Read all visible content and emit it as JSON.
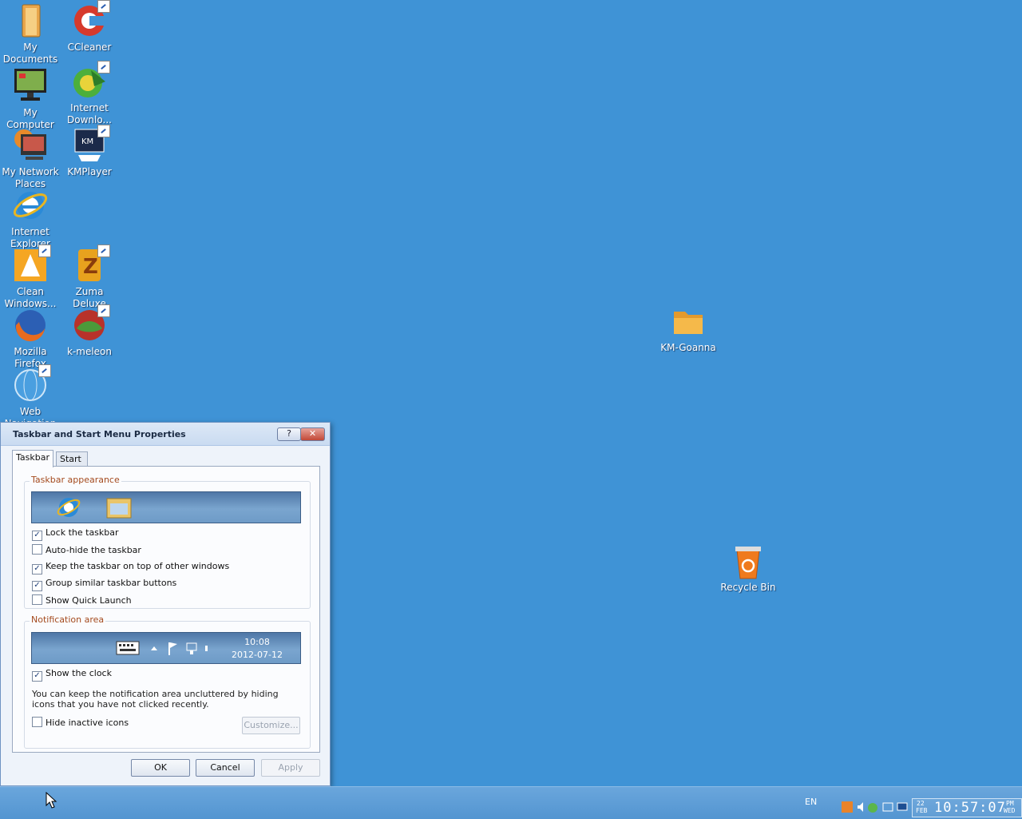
{
  "desktop": {
    "icons": [
      {
        "label": "My Documents"
      },
      {
        "label": "CCleaner"
      },
      {
        "label": "My Computer"
      },
      {
        "label": "Internet Downlo..."
      },
      {
        "label": "My Network Places"
      },
      {
        "label": "KMPlayer"
      },
      {
        "label": "Internet Explorer"
      },
      {
        "label": "Clean Windows..."
      },
      {
        "label": "Zuma Deluxe"
      },
      {
        "label": "Mozilla Firefox"
      },
      {
        "label": "k-meleon"
      },
      {
        "label": "Web Navigation"
      },
      {
        "label": "KM-Goanna"
      },
      {
        "label": "Recycle Bin"
      }
    ]
  },
  "dialog": {
    "title": "Taskbar and Start Menu Properties",
    "help_label": "?",
    "close_label": "✕",
    "tabs": [
      {
        "label": "Taskbar"
      },
      {
        "label": "Start Menu"
      }
    ],
    "appearance": {
      "group_label": "Taskbar appearance",
      "options": [
        {
          "label": "Lock the taskbar",
          "mark": "✓"
        },
        {
          "label": "Auto-hide the taskbar",
          "mark": ""
        },
        {
          "label": "Keep the taskbar on top of other windows",
          "mark": "✓"
        },
        {
          "label": "Group similar taskbar buttons",
          "mark": "✓"
        },
        {
          "label": "Show Quick Launch",
          "mark": ""
        }
      ]
    },
    "notification": {
      "group_label": "Notification area",
      "preview_time": "10:08",
      "preview_date": "2012-07-12",
      "show_clock": {
        "label": "Show the clock",
        "mark": "✓"
      },
      "note": "You can keep the notification area uncluttered by hiding icons that you have not clicked recently.",
      "hide_inactive": {
        "label": "Hide inactive icons",
        "mark": ""
      },
      "customize_label": "Customize..."
    },
    "buttons": {
      "ok": "OK",
      "cancel": "Cancel",
      "apply": "Apply"
    }
  },
  "taskbar": {
    "language": "EN",
    "clock": {
      "day": "22",
      "month": "FEB",
      "time": "10:57:07",
      "ampm": "PM",
      "weekday": "WED"
    }
  }
}
